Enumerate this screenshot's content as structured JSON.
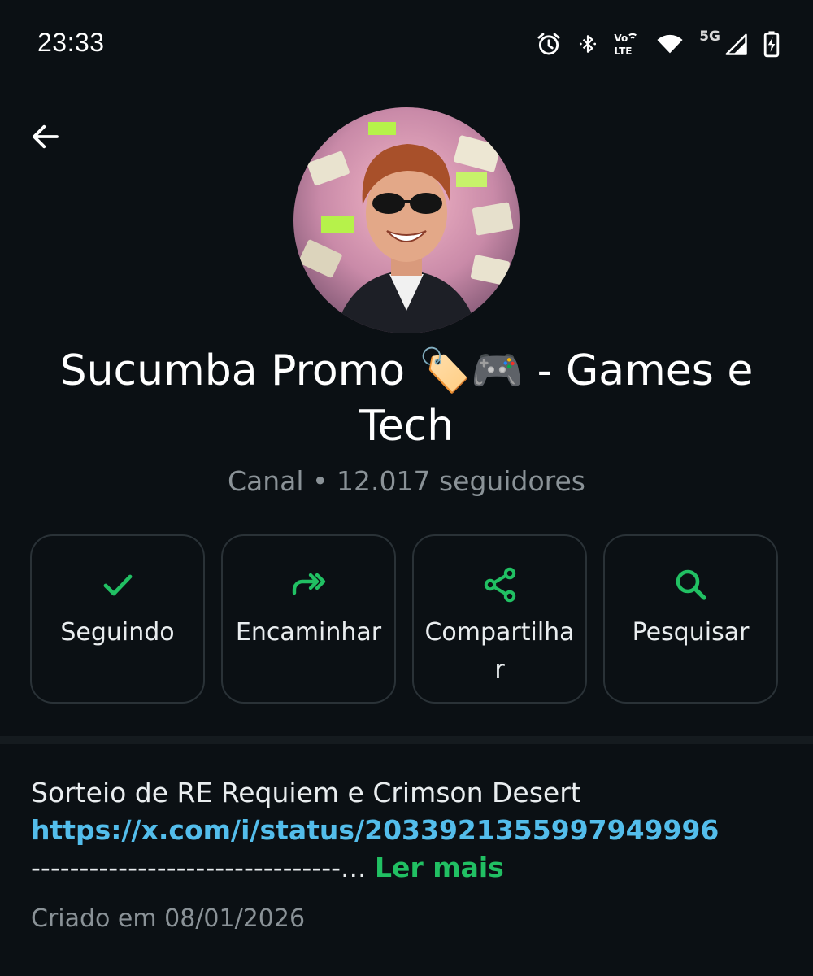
{
  "status_bar": {
    "time": "23:33",
    "network_label": "5G",
    "icons": [
      "alarm-icon",
      "bluetooth-icon",
      "volte-icon",
      "wifi-icon",
      "cell-signal-icon",
      "battery-charging-icon"
    ]
  },
  "header": {
    "back_icon": "arrow-left-icon",
    "title": "Sucumba Promo 🏷️🎮  - Games e Tech",
    "meta": "Canal • 12.017 seguidores"
  },
  "actions": [
    {
      "label": "Seguindo",
      "icon": "check-icon"
    },
    {
      "label": "Encaminhar",
      "icon": "forward-icon"
    },
    {
      "label": "Compartilhar",
      "icon": "share-icon"
    },
    {
      "label": "Pesquisar",
      "icon": "search-icon"
    }
  ],
  "description": {
    "line1": "Sorteio de RE Requiem e Crimson Desert",
    "link": "https://x.com/i/status/2033921355997949996",
    "dashes": "--------------------------------...",
    "read_more": "Ler mais",
    "created": "Criado em 08/01/2026"
  },
  "colors": {
    "background": "#0b1014",
    "accent": "#21c063",
    "link": "#53bdeb",
    "muted": "#8a9297"
  }
}
